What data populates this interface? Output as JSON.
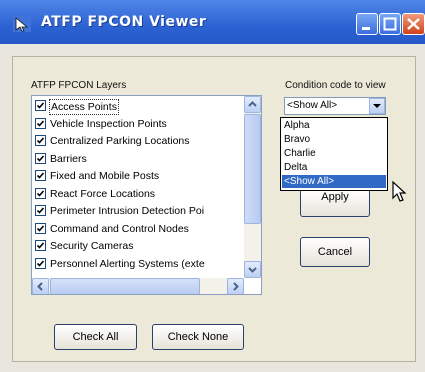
{
  "window": {
    "title": "ATFP FPCON Viewer"
  },
  "layers": {
    "label": "ATFP FPCON Layers",
    "items": [
      {
        "label": "Access Points",
        "checked": true,
        "selected": true
      },
      {
        "label": "Vehicle Inspection Points",
        "checked": true
      },
      {
        "label": "Centralized Parking Locations",
        "checked": true
      },
      {
        "label": "Barriers",
        "checked": true
      },
      {
        "label": "Fixed and Mobile Posts",
        "checked": true
      },
      {
        "label": "React Force Locations",
        "checked": true
      },
      {
        "label": "Perimeter Intrusion Detection Poi",
        "checked": true
      },
      {
        "label": "Command and Control Nodes",
        "checked": true
      },
      {
        "label": "Security Cameras",
        "checked": true
      },
      {
        "label": "Personnel Alerting Systems (exte",
        "checked": true
      }
    ]
  },
  "condition": {
    "label": "Condition code to view",
    "selected": "<Show All>",
    "options": [
      "Alpha",
      "Bravo",
      "Charlie",
      "Delta",
      "<Show All>"
    ],
    "highlighted_index": 4
  },
  "buttons": {
    "apply": "Apply",
    "cancel": "Cancel",
    "check_all": "Check All",
    "check_none": "Check None"
  },
  "colors": {
    "titlebar": "#2d62d4",
    "selection": "#316ac5",
    "close": "#d1421d"
  }
}
